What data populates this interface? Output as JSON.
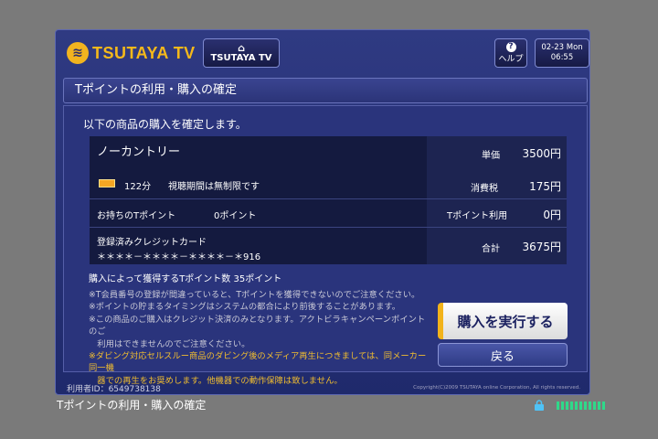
{
  "header": {
    "logo_text": "TSUTAYA TV",
    "home_label": "TSUTAYA TV",
    "help_label": "ヘルプ",
    "clock_date": "02-23 Mon",
    "clock_time": "06:55"
  },
  "panel": {
    "title": "Tポイントの利用・購入の確定",
    "confirm_message": "以下の商品の購入を確定します。"
  },
  "product": {
    "title": "ノーカントリー",
    "duration": "122分",
    "viewing_period": "視聴期間は無制限です",
    "unit_price_label": "単価",
    "unit_price": "3500円",
    "tax_label": "消費税",
    "tax": "175円"
  },
  "points": {
    "owned_label": "お持ちのTポイント",
    "owned_value": "0ポイント",
    "use_label": "Tポイント利用",
    "use_value": "0円"
  },
  "payment": {
    "card_label": "登録済みクレジットカード",
    "card_number": "＊＊＊＊－＊＊＊＊－＊＊＊＊－＊916",
    "total_label": "合計",
    "total": "3675円"
  },
  "earn": {
    "label": "購入によって獲得するTポイント数",
    "value": "35ポイント"
  },
  "notes": [
    "※T会員番号の登録が間違っていると、Tポイントを獲得できないのでご注意ください。",
    "※ポイントの貯まるタイミングはシステムの都合により前後することがあります。",
    "※この商品のご購入はクレジット決済のみとなります。アクトビラキャンペーンポイントのご",
    "　利用はできませんのでご注意ください。"
  ],
  "warning": [
    "※ダビング対応セルスルー商品のダビング後のメディア再生につきましては、同メーカー同一機",
    "　器での再生をお奨めします。他機器での動作保障は致しません。"
  ],
  "buttons": {
    "execute": "購入を実行する",
    "back": "戻る"
  },
  "footer": {
    "user_id": "利用者ID：6549738138",
    "copyright": "Copyright(C)2009 TSUTAYA online Corporation, All rights reserved."
  },
  "status_bar": {
    "screen_label": "Tポイントの利用・購入の確定"
  },
  "colors": {
    "accent": "#f2b31a",
    "frame": "#2b357a"
  }
}
